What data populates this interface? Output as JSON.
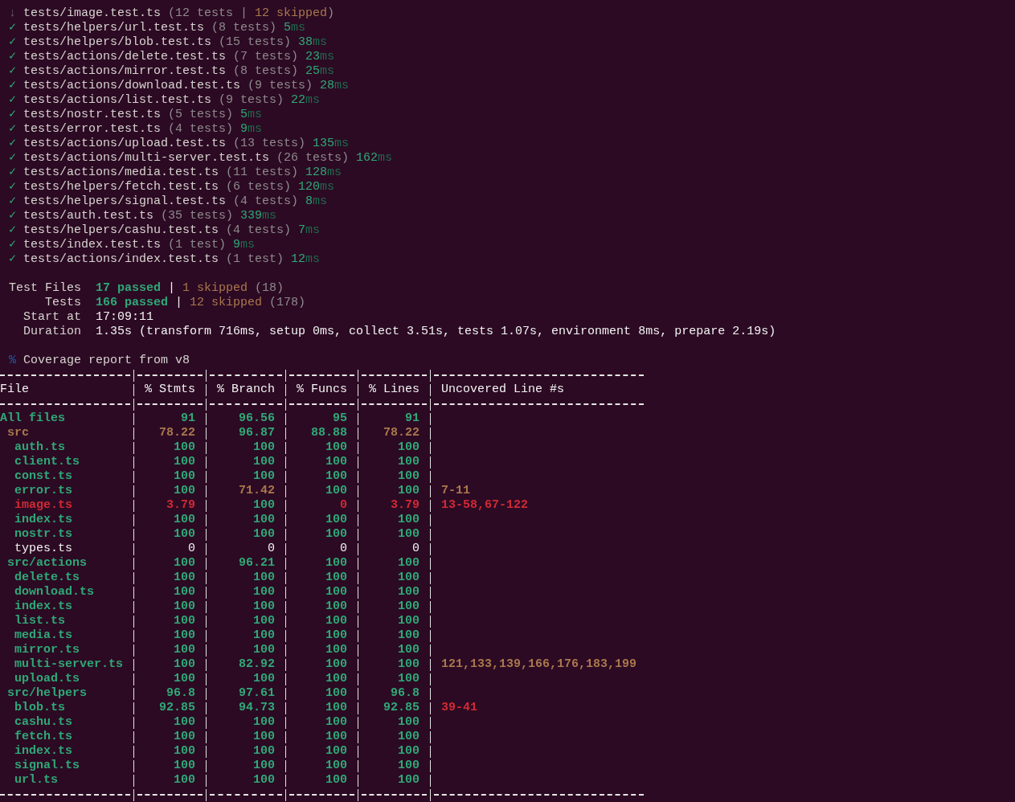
{
  "test_results": [
    {
      "kind": "skipped",
      "mark": "↓",
      "file": "tests/image.test.ts",
      "details": [
        {
          "text": "(12 tests |",
          "kind": "dim"
        },
        {
          "text": "12 skipped",
          "kind": "skipped"
        },
        {
          "text": ")",
          "kind": "close"
        }
      ]
    },
    {
      "kind": "passed",
      "mark": "✓",
      "file": "tests/helpers/url.test.ts",
      "details": [
        {
          "text": "(8 tests)",
          "kind": "dim"
        },
        {
          "text": "5",
          "kind": "time"
        },
        {
          "text": "ms",
          "kind": "unit"
        }
      ]
    },
    {
      "kind": "passed",
      "mark": "✓",
      "file": "tests/helpers/blob.test.ts",
      "details": [
        {
          "text": "(15 tests)",
          "kind": "dim"
        },
        {
          "text": "38",
          "kind": "time"
        },
        {
          "text": "ms",
          "kind": "unit"
        }
      ]
    },
    {
      "kind": "passed",
      "mark": "✓",
      "file": "tests/actions/delete.test.ts",
      "details": [
        {
          "text": "(7 tests)",
          "kind": "dim"
        },
        {
          "text": "23",
          "kind": "time"
        },
        {
          "text": "ms",
          "kind": "unit"
        }
      ]
    },
    {
      "kind": "passed",
      "mark": "✓",
      "file": "tests/actions/mirror.test.ts",
      "details": [
        {
          "text": "(8 tests)",
          "kind": "dim"
        },
        {
          "text": "25",
          "kind": "time"
        },
        {
          "text": "ms",
          "kind": "unit"
        }
      ]
    },
    {
      "kind": "passed",
      "mark": "✓",
      "file": "tests/actions/download.test.ts",
      "details": [
        {
          "text": "(9 tests)",
          "kind": "dim"
        },
        {
          "text": "28",
          "kind": "time"
        },
        {
          "text": "ms",
          "kind": "unit"
        }
      ]
    },
    {
      "kind": "passed",
      "mark": "✓",
      "file": "tests/actions/list.test.ts",
      "details": [
        {
          "text": "(9 tests)",
          "kind": "dim"
        },
        {
          "text": "22",
          "kind": "time"
        },
        {
          "text": "ms",
          "kind": "unit"
        }
      ]
    },
    {
      "kind": "passed",
      "mark": "✓",
      "file": "tests/nostr.test.ts",
      "details": [
        {
          "text": "(5 tests)",
          "kind": "dim"
        },
        {
          "text": "5",
          "kind": "time"
        },
        {
          "text": "ms",
          "kind": "unit"
        }
      ]
    },
    {
      "kind": "passed",
      "mark": "✓",
      "file": "tests/error.test.ts",
      "details": [
        {
          "text": "(4 tests)",
          "kind": "dim"
        },
        {
          "text": "9",
          "kind": "time"
        },
        {
          "text": "ms",
          "kind": "unit"
        }
      ]
    },
    {
      "kind": "passed",
      "mark": "✓",
      "file": "tests/actions/upload.test.ts",
      "details": [
        {
          "text": "(13 tests)",
          "kind": "dim"
        },
        {
          "text": "135",
          "kind": "time"
        },
        {
          "text": "ms",
          "kind": "unit"
        }
      ]
    },
    {
      "kind": "passed",
      "mark": "✓",
      "file": "tests/actions/multi-server.test.ts",
      "details": [
        {
          "text": "(26 tests)",
          "kind": "dim"
        },
        {
          "text": "162",
          "kind": "time"
        },
        {
          "text": "ms",
          "kind": "unit"
        }
      ]
    },
    {
      "kind": "passed",
      "mark": "✓",
      "file": "tests/actions/media.test.ts",
      "details": [
        {
          "text": "(11 tests)",
          "kind": "dim"
        },
        {
          "text": "128",
          "kind": "time"
        },
        {
          "text": "ms",
          "kind": "unit"
        }
      ]
    },
    {
      "kind": "passed",
      "mark": "✓",
      "file": "tests/helpers/fetch.test.ts",
      "details": [
        {
          "text": "(6 tests)",
          "kind": "dim"
        },
        {
          "text": "120",
          "kind": "time"
        },
        {
          "text": "ms",
          "kind": "unit"
        }
      ]
    },
    {
      "kind": "passed",
      "mark": "✓",
      "file": "tests/helpers/signal.test.ts",
      "details": [
        {
          "text": "(4 tests)",
          "kind": "dim"
        },
        {
          "text": "8",
          "kind": "time"
        },
        {
          "text": "ms",
          "kind": "unit"
        }
      ]
    },
    {
      "kind": "passed",
      "mark": "✓",
      "file": "tests/auth.test.ts",
      "details": [
        {
          "text": "(35 tests)",
          "kind": "dim"
        },
        {
          "text": "339",
          "kind": "time"
        },
        {
          "text": "ms",
          "kind": "unit"
        }
      ]
    },
    {
      "kind": "passed",
      "mark": "✓",
      "file": "tests/helpers/cashu.test.ts",
      "details": [
        {
          "text": "(4 tests)",
          "kind": "dim"
        },
        {
          "text": "7",
          "kind": "time"
        },
        {
          "text": "ms",
          "kind": "unit"
        }
      ]
    },
    {
      "kind": "passed",
      "mark": "✓",
      "file": "tests/index.test.ts",
      "details": [
        {
          "text": "(1 test)",
          "kind": "dim"
        },
        {
          "text": "9",
          "kind": "time"
        },
        {
          "text": "ms",
          "kind": "unit"
        }
      ]
    },
    {
      "kind": "passed",
      "mark": "✓",
      "file": "tests/actions/index.test.ts",
      "details": [
        {
          "text": "(1 test)",
          "kind": "dim"
        },
        {
          "text": "12",
          "kind": "time"
        },
        {
          "text": "ms",
          "kind": "unit"
        }
      ]
    }
  ],
  "summary": [
    {
      "label": "Test Files",
      "parts": [
        {
          "text": "17 passed",
          "kind": "passed"
        },
        {
          "text": "|",
          "kind": "plain"
        },
        {
          "text": "1 skipped",
          "kind": "skipped"
        },
        {
          "text": "(18)",
          "kind": "dim"
        }
      ]
    },
    {
      "label": "Tests",
      "parts": [
        {
          "text": "166 passed",
          "kind": "passed"
        },
        {
          "text": "|",
          "kind": "plain"
        },
        {
          "text": "12 skipped",
          "kind": "skipped"
        },
        {
          "text": "(178)",
          "kind": "dim"
        }
      ]
    },
    {
      "label": "Start at",
      "parts": [
        {
          "text": "17:09:11",
          "kind": "plain"
        }
      ]
    },
    {
      "label": "Duration",
      "parts": [
        {
          "text": "1.35s (transform 716ms, setup 0ms, collect 3.51s, tests 1.07s, environment 8ms, prepare 2.19s)",
          "kind": "plain"
        }
      ]
    }
  ],
  "coverage": {
    "prefix": "%",
    "title": "Coverage report from v8",
    "columns": [
      "File",
      "% Stmts",
      "% Branch",
      "% Funcs",
      "% Lines",
      "Uncovered Line #s"
    ],
    "rows": [
      {
        "file": "All files",
        "kind": "high",
        "stmts": {
          "value": "91",
          "kind": "high"
        },
        "branch": {
          "value": "96.56",
          "kind": "high"
        },
        "funcs": {
          "value": "95",
          "kind": "high"
        },
        "lines": {
          "value": "91",
          "kind": "high"
        },
        "children": [
          {
            "file": "src",
            "kind": "medium",
            "stmts": {
              "value": "78.22",
              "kind": "medium"
            },
            "branch": {
              "value": "96.87",
              "kind": "high"
            },
            "funcs": {
              "value": "88.88",
              "kind": "high"
            },
            "lines": {
              "value": "78.22",
              "kind": "medium"
            },
            "children": [
              {
                "file": "auth.ts",
                "kind": "high",
                "stmts": {
                  "value": "100",
                  "kind": "high"
                },
                "branch": {
                  "value": "100",
                  "kind": "high"
                },
                "funcs": {
                  "value": "100",
                  "kind": "high"
                },
                "lines": {
                  "value": "100",
                  "kind": "high"
                }
              },
              {
                "file": "client.ts",
                "kind": "high",
                "stmts": {
                  "value": "100",
                  "kind": "high"
                },
                "branch": {
                  "value": "100",
                  "kind": "high"
                },
                "funcs": {
                  "value": "100",
                  "kind": "high"
                },
                "lines": {
                  "value": "100",
                  "kind": "high"
                }
              },
              {
                "file": "const.ts",
                "kind": "high",
                "stmts": {
                  "value": "100",
                  "kind": "high"
                },
                "branch": {
                  "value": "100",
                  "kind": "high"
                },
                "funcs": {
                  "value": "100",
                  "kind": "high"
                },
                "lines": {
                  "value": "100",
                  "kind": "high"
                }
              },
              {
                "file": "error.ts",
                "kind": "high",
                "stmts": {
                  "value": "100",
                  "kind": "high"
                },
                "branch": {
                  "value": "71.42",
                  "kind": "medium"
                },
                "funcs": {
                  "value": "100",
                  "kind": "high"
                },
                "lines": {
                  "value": "100",
                  "kind": "high"
                },
                "uncovered": {
                  "value": "7-11",
                  "kind": "medium"
                }
              },
              {
                "file": "image.ts",
                "kind": "low",
                "stmts": {
                  "value": "3.79",
                  "kind": "low"
                },
                "branch": {
                  "value": "100",
                  "kind": "high"
                },
                "funcs": {
                  "value": "0",
                  "kind": "low"
                },
                "lines": {
                  "value": "3.79",
                  "kind": "low"
                },
                "uncovered": {
                  "value": "13-58,67-122",
                  "kind": "low"
                }
              },
              {
                "file": "index.ts",
                "kind": "high",
                "stmts": {
                  "value": "100",
                  "kind": "high"
                },
                "branch": {
                  "value": "100",
                  "kind": "high"
                },
                "funcs": {
                  "value": "100",
                  "kind": "high"
                },
                "lines": {
                  "value": "100",
                  "kind": "high"
                }
              },
              {
                "file": "nostr.ts",
                "kind": "high",
                "stmts": {
                  "value": "100",
                  "kind": "high"
                },
                "branch": {
                  "value": "100",
                  "kind": "high"
                },
                "funcs": {
                  "value": "100",
                  "kind": "high"
                },
                "lines": {
                  "value": "100",
                  "kind": "high"
                }
              },
              {
                "file": "types.ts",
                "kind": "none",
                "stmts": {
                  "value": "0",
                  "kind": "none"
                },
                "branch": {
                  "value": "0",
                  "kind": "none"
                },
                "funcs": {
                  "value": "0",
                  "kind": "none"
                },
                "lines": {
                  "value": "0",
                  "kind": "none"
                }
              }
            ]
          },
          {
            "file": "src/actions",
            "kind": "high",
            "stmts": {
              "value": "100",
              "kind": "high"
            },
            "branch": {
              "value": "96.21",
              "kind": "high"
            },
            "funcs": {
              "value": "100",
              "kind": "high"
            },
            "lines": {
              "value": "100",
              "kind": "high"
            },
            "children": [
              {
                "file": "delete.ts",
                "kind": "high",
                "stmts": {
                  "value": "100",
                  "kind": "high"
                },
                "branch": {
                  "value": "100",
                  "kind": "high"
                },
                "funcs": {
                  "value": "100",
                  "kind": "high"
                },
                "lines": {
                  "value": "100",
                  "kind": "high"
                }
              },
              {
                "file": "download.ts",
                "kind": "high",
                "stmts": {
                  "value": "100",
                  "kind": "high"
                },
                "branch": {
                  "value": "100",
                  "kind": "high"
                },
                "funcs": {
                  "value": "100",
                  "kind": "high"
                },
                "lines": {
                  "value": "100",
                  "kind": "high"
                }
              },
              {
                "file": "index.ts",
                "kind": "high",
                "stmts": {
                  "value": "100",
                  "kind": "high"
                },
                "branch": {
                  "value": "100",
                  "kind": "high"
                },
                "funcs": {
                  "value": "100",
                  "kind": "high"
                },
                "lines": {
                  "value": "100",
                  "kind": "high"
                }
              },
              {
                "file": "list.ts",
                "kind": "high",
                "stmts": {
                  "value": "100",
                  "kind": "high"
                },
                "branch": {
                  "value": "100",
                  "kind": "high"
                },
                "funcs": {
                  "value": "100",
                  "kind": "high"
                },
                "lines": {
                  "value": "100",
                  "kind": "high"
                }
              },
              {
                "file": "media.ts",
                "kind": "high",
                "stmts": {
                  "value": "100",
                  "kind": "high"
                },
                "branch": {
                  "value": "100",
                  "kind": "high"
                },
                "funcs": {
                  "value": "100",
                  "kind": "high"
                },
                "lines": {
                  "value": "100",
                  "kind": "high"
                }
              },
              {
                "file": "mirror.ts",
                "kind": "high",
                "stmts": {
                  "value": "100",
                  "kind": "high"
                },
                "branch": {
                  "value": "100",
                  "kind": "high"
                },
                "funcs": {
                  "value": "100",
                  "kind": "high"
                },
                "lines": {
                  "value": "100",
                  "kind": "high"
                }
              },
              {
                "file": "multi-server.ts",
                "kind": "high",
                "stmts": {
                  "value": "100",
                  "kind": "high"
                },
                "branch": {
                  "value": "82.92",
                  "kind": "high"
                },
                "funcs": {
                  "value": "100",
                  "kind": "high"
                },
                "lines": {
                  "value": "100",
                  "kind": "high"
                },
                "uncovered": {
                  "value": "121,133,139,166,176,183,199",
                  "kind": "medium"
                }
              },
              {
                "file": "upload.ts",
                "kind": "high",
                "stmts": {
                  "value": "100",
                  "kind": "high"
                },
                "branch": {
                  "value": "100",
                  "kind": "high"
                },
                "funcs": {
                  "value": "100",
                  "kind": "high"
                },
                "lines": {
                  "value": "100",
                  "kind": "high"
                }
              }
            ]
          },
          {
            "file": "src/helpers",
            "kind": "high",
            "stmts": {
              "value": "96.8",
              "kind": "high"
            },
            "branch": {
              "value": "97.61",
              "kind": "high"
            },
            "funcs": {
              "value": "100",
              "kind": "high"
            },
            "lines": {
              "value": "96.8",
              "kind": "high"
            },
            "children": [
              {
                "file": "blob.ts",
                "kind": "high",
                "stmts": {
                  "value": "92.85",
                  "kind": "high"
                },
                "branch": {
                  "value": "94.73",
                  "kind": "high"
                },
                "funcs": {
                  "value": "100",
                  "kind": "high"
                },
                "lines": {
                  "value": "92.85",
                  "kind": "high"
                },
                "uncovered": {
                  "value": "39-41",
                  "kind": "low"
                }
              },
              {
                "file": "cashu.ts",
                "kind": "high",
                "stmts": {
                  "value": "100",
                  "kind": "high"
                },
                "branch": {
                  "value": "100",
                  "kind": "high"
                },
                "funcs": {
                  "value": "100",
                  "kind": "high"
                },
                "lines": {
                  "value": "100",
                  "kind": "high"
                }
              },
              {
                "file": "fetch.ts",
                "kind": "high",
                "stmts": {
                  "value": "100",
                  "kind": "high"
                },
                "branch": {
                  "value": "100",
                  "kind": "high"
                },
                "funcs": {
                  "value": "100",
                  "kind": "high"
                },
                "lines": {
                  "value": "100",
                  "kind": "high"
                }
              },
              {
                "file": "index.ts",
                "kind": "high",
                "stmts": {
                  "value": "100",
                  "kind": "high"
                },
                "branch": {
                  "value": "100",
                  "kind": "high"
                },
                "funcs": {
                  "value": "100",
                  "kind": "high"
                },
                "lines": {
                  "value": "100",
                  "kind": "high"
                }
              },
              {
                "file": "signal.ts",
                "kind": "high",
                "stmts": {
                  "value": "100",
                  "kind": "high"
                },
                "branch": {
                  "value": "100",
                  "kind": "high"
                },
                "funcs": {
                  "value": "100",
                  "kind": "high"
                },
                "lines": {
                  "value": "100",
                  "kind": "high"
                }
              },
              {
                "file": "url.ts",
                "kind": "high",
                "stmts": {
                  "value": "100",
                  "kind": "high"
                },
                "branch": {
                  "value": "100",
                  "kind": "high"
                },
                "funcs": {
                  "value": "100",
                  "kind": "high"
                },
                "lines": {
                  "value": "100",
                  "kind": "high"
                }
              }
            ]
          }
        ]
      }
    ]
  }
}
